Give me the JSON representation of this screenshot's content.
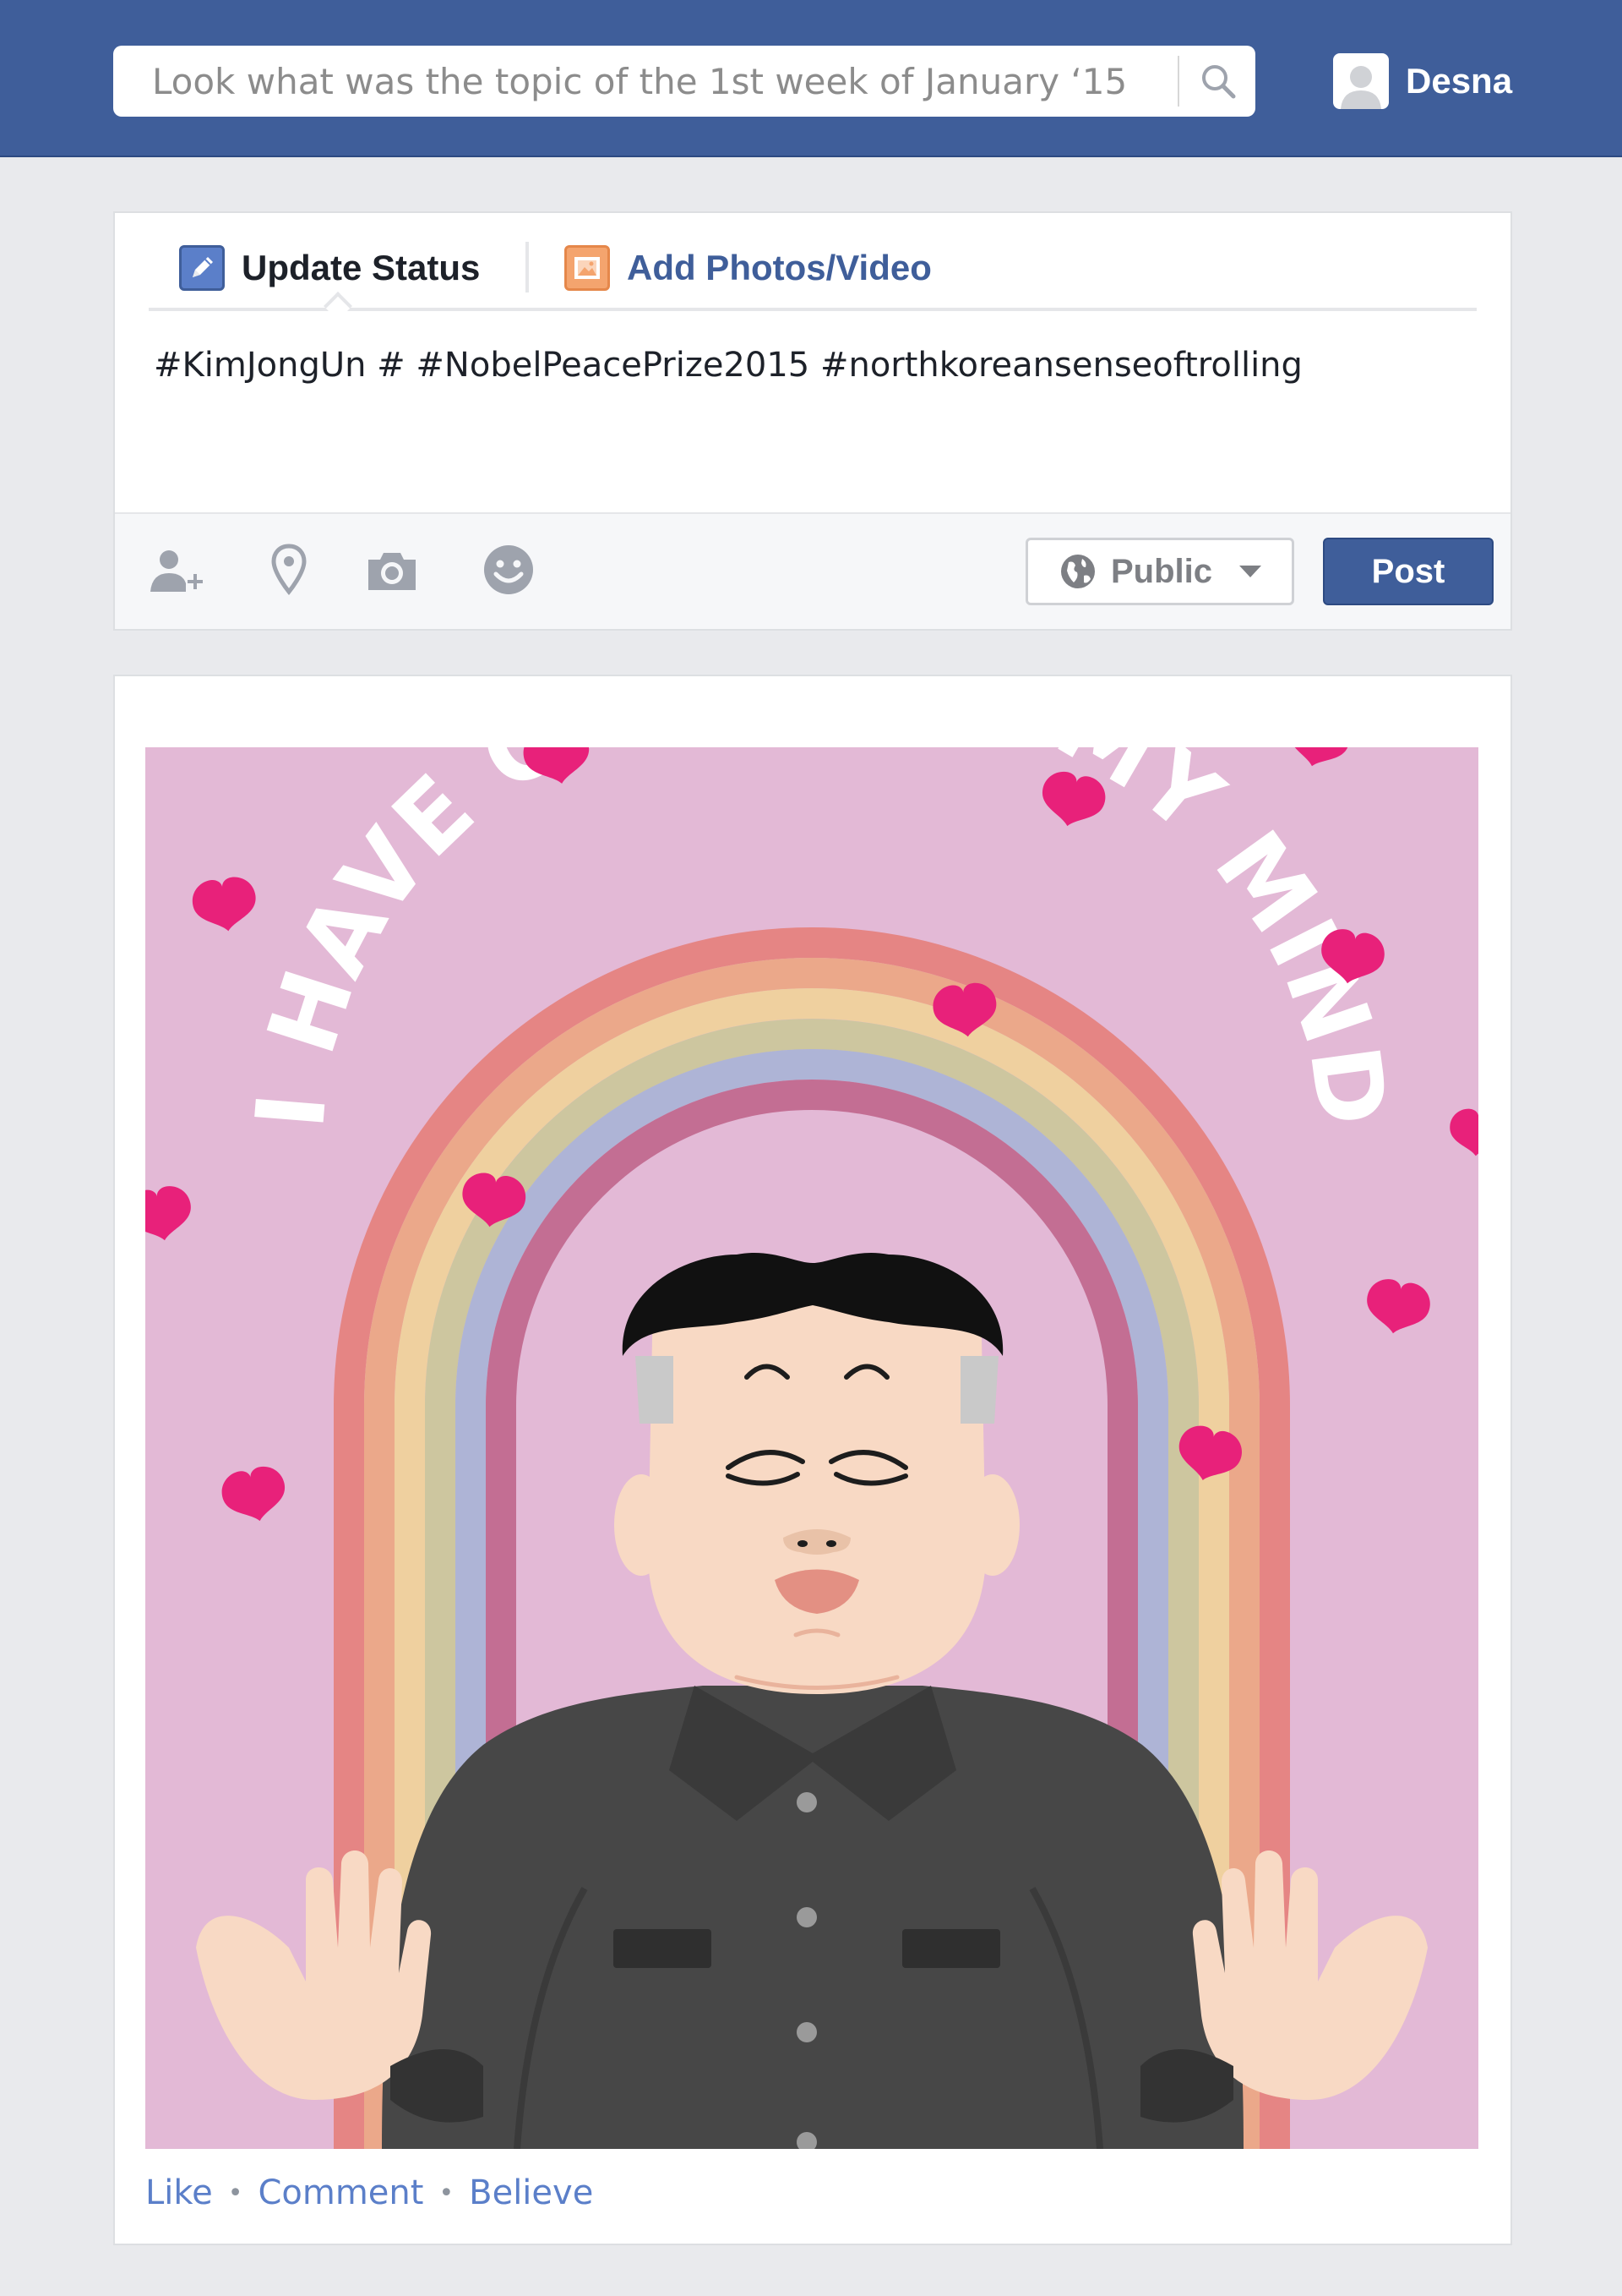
{
  "search": {
    "placeholder": "Look what was the topic of the 1st week of January ‘15",
    "icon": "search-icon"
  },
  "user": {
    "name": "Desna",
    "avatar_icon": "person-silhouette-icon"
  },
  "composer": {
    "tabs": [
      {
        "label": "Update Status",
        "icon": "pencil-icon",
        "active": true
      },
      {
        "label": "Add Photos/Video",
        "icon": "photo-icon",
        "active": false
      }
    ],
    "status_text": "#KimJongUn # #NobelPeacePrize2015 #northkoreansenseoftrolling",
    "footer_icons": [
      "tag-friends-icon",
      "location-pin-icon",
      "camera-icon",
      "smiley-icon"
    ],
    "audience_label": "Public",
    "post_label": "Post"
  },
  "post": {
    "image_text": "I HAVE CHANGED MY MIND",
    "actions": [
      "Like",
      "Comment",
      "Believe"
    ]
  },
  "colors": {
    "brand": "#3f5e9a",
    "link": "#5b7fc9",
    "image_background": "#e3b9d6",
    "heart": "#e8217a"
  }
}
